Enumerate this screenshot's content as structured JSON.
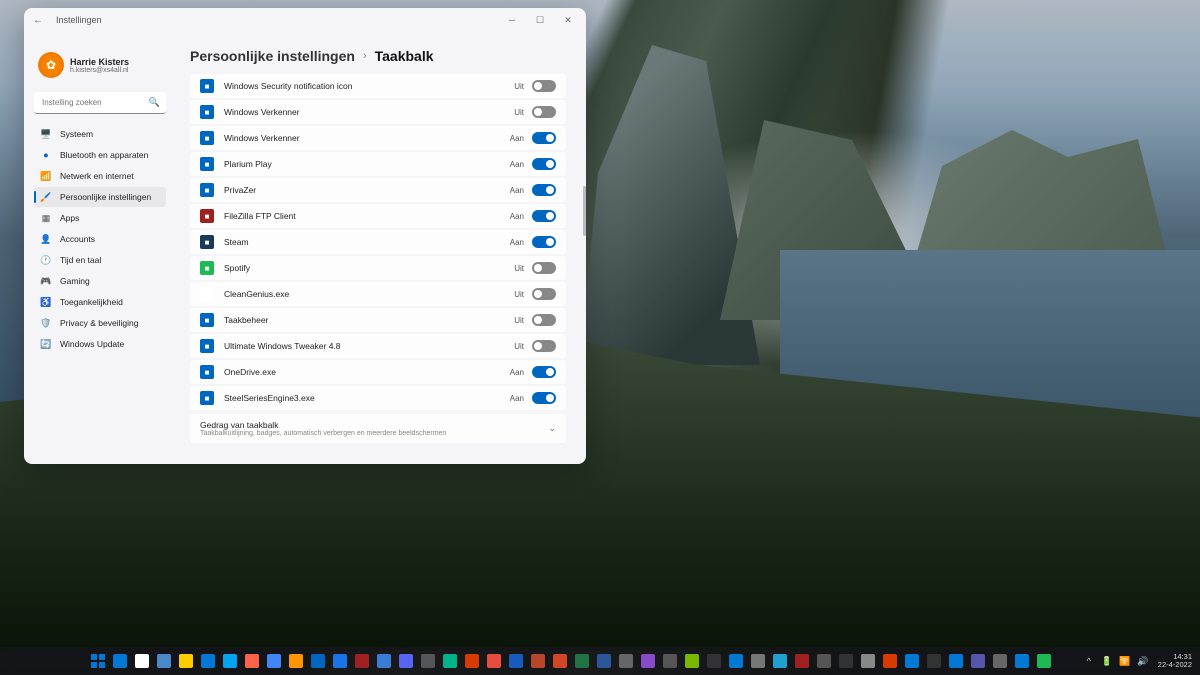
{
  "window": {
    "title": "Instellingen",
    "profile": {
      "name": "Harrie Kisters",
      "email": "h.kisters@xs4all.nl"
    },
    "search_placeholder": "Instelling zoeken"
  },
  "sidebar": {
    "items": [
      {
        "icon": "🖥️",
        "label": "Systeem",
        "color": "#555"
      },
      {
        "icon": "●",
        "label": "Bluetooth en apparaten",
        "color": "#0067c0"
      },
      {
        "icon": "📶",
        "label": "Netwerk en internet",
        "color": "#0067c0"
      },
      {
        "icon": "🖌️",
        "label": "Persoonlijke instellingen",
        "color": "#d06090",
        "active": true
      },
      {
        "icon": "▦",
        "label": "Apps",
        "color": "#555"
      },
      {
        "icon": "👤",
        "label": "Accounts",
        "color": "#e6a050"
      },
      {
        "icon": "🕐",
        "label": "Tijd en taal",
        "color": "#555"
      },
      {
        "icon": "🎮",
        "label": "Gaming",
        "color": "#555"
      },
      {
        "icon": "♿",
        "label": "Toegankelijkheid",
        "color": "#555"
      },
      {
        "icon": "🛡️",
        "label": "Privacy & beveiliging",
        "color": "#0067c0"
      },
      {
        "icon": "🔄",
        "label": "Windows Update",
        "color": "#0067c0"
      }
    ]
  },
  "breadcrumb": {
    "parent": "Persoonlijke instellingen",
    "current": "Taakbalk"
  },
  "state_labels": {
    "on": "Aan",
    "off": "Uit"
  },
  "settings": [
    {
      "name": "Windows Security notification icon",
      "on": false,
      "bg": "#0067c0"
    },
    {
      "name": "Windows Verkenner",
      "on": false,
      "bg": "#0067c0"
    },
    {
      "name": "Windows Verkenner",
      "on": true,
      "bg": "#0067c0"
    },
    {
      "name": "Plarium Play",
      "on": true,
      "bg": "#0067c0"
    },
    {
      "name": "PrivaZer",
      "on": true,
      "bg": "#0067c0"
    },
    {
      "name": "FileZilla FTP Client",
      "on": true,
      "bg": "#a02020"
    },
    {
      "name": "Steam",
      "on": true,
      "bg": "#1a3a5a"
    },
    {
      "name": "Spotify",
      "on": false,
      "bg": "#1db954"
    },
    {
      "name": "CleanGenius.exe",
      "on": false,
      "bg": "#ffffff"
    },
    {
      "name": "Taakbeheer",
      "on": false,
      "bg": "#0067c0"
    },
    {
      "name": "Ultimate Windows Tweaker 4.8",
      "on": false,
      "bg": "#0067c0"
    },
    {
      "name": "OneDrive.exe",
      "on": true,
      "bg": "#0067c0"
    },
    {
      "name": "SteelSeriesEngine3.exe",
      "on": true,
      "bg": "#0067c0"
    }
  ],
  "expander": {
    "title": "Gedrag van taakbalk",
    "subtitle": "Taakbalkuitlijning, badges, automatisch verbergen en meerdere beeldschermen"
  },
  "taskbar": {
    "icons": [
      {
        "c": "#0078d4"
      },
      {
        "c": "#ffffff"
      },
      {
        "c": "#4a88c7"
      },
      {
        "c": "#ffcc00"
      },
      {
        "c": "#0078d4"
      },
      {
        "c": "#00a4ef"
      },
      {
        "c": "#ff6347"
      },
      {
        "c": "#4285f4"
      },
      {
        "c": "#ff9500"
      },
      {
        "c": "#0067c0"
      },
      {
        "c": "#1a73e8"
      },
      {
        "c": "#a02020"
      },
      {
        "c": "#3a7bd5"
      },
      {
        "c": "#5865f2"
      },
      {
        "c": "#555555"
      },
      {
        "c": "#00b388"
      },
      {
        "c": "#d83b01"
      },
      {
        "c": "#e74c3c"
      },
      {
        "c": "#185abd"
      },
      {
        "c": "#b7472a"
      },
      {
        "c": "#d24726"
      },
      {
        "c": "#217346"
      },
      {
        "c": "#2b579a"
      },
      {
        "c": "#666666"
      },
      {
        "c": "#8a4bc9"
      },
      {
        "c": "#555555"
      },
      {
        "c": "#76b900"
      },
      {
        "c": "#333333"
      },
      {
        "c": "#0078d4"
      },
      {
        "c": "#777777"
      },
      {
        "c": "#20a0d0"
      },
      {
        "c": "#a02020"
      },
      {
        "c": "#555555"
      },
      {
        "c": "#333333"
      },
      {
        "c": "#888888"
      },
      {
        "c": "#d83b01"
      },
      {
        "c": "#0078d4"
      },
      {
        "c": "#333333"
      },
      {
        "c": "#0078d4"
      },
      {
        "c": "#5555aa"
      },
      {
        "c": "#666666"
      },
      {
        "c": "#0078d4"
      },
      {
        "c": "#1db954"
      }
    ],
    "time": "14:31",
    "date": "22-4-2022"
  }
}
